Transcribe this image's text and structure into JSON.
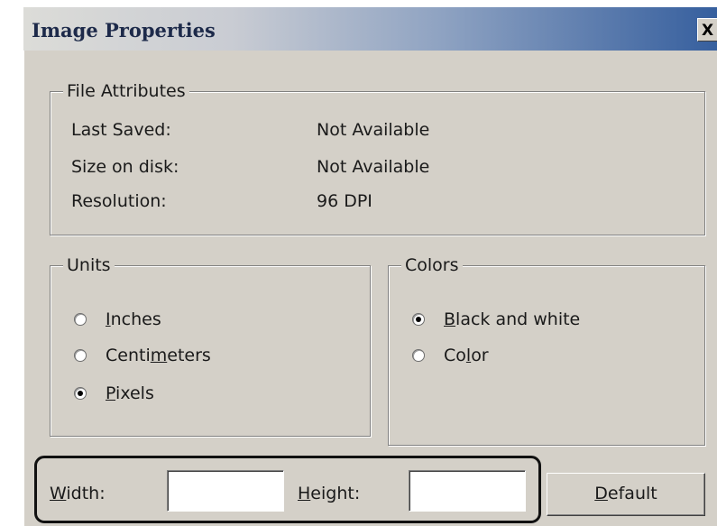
{
  "window": {
    "title": "Image Properties",
    "close_label": "X"
  },
  "file_attributes": {
    "legend": "File Attributes",
    "rows": [
      {
        "label": "Last Saved:",
        "value": "Not Available"
      },
      {
        "label": "Size on disk:",
        "value": "Not Available"
      },
      {
        "label": "Resolution:",
        "value": "96 DPI"
      }
    ]
  },
  "units": {
    "legend": "Units",
    "options": [
      {
        "pre": "",
        "key": "I",
        "post": "nches",
        "selected": false
      },
      {
        "pre": "Centi",
        "key": "m",
        "post": "eters",
        "selected": false
      },
      {
        "pre": "",
        "key": "P",
        "post": "ixels",
        "selected": true
      }
    ]
  },
  "colors": {
    "legend": "Colors",
    "options": [
      {
        "pre": "",
        "key": "B",
        "post": "lack and white",
        "selected": true
      },
      {
        "pre": "Co",
        "key": "l",
        "post": "or",
        "selected": false
      }
    ]
  },
  "size": {
    "width_label": {
      "key": "W",
      "post": "idth:"
    },
    "height_label": {
      "key": "H",
      "post": "eight:"
    },
    "width_value": "",
    "height_value": ""
  },
  "default_button": {
    "key": "D",
    "post": "efault"
  }
}
